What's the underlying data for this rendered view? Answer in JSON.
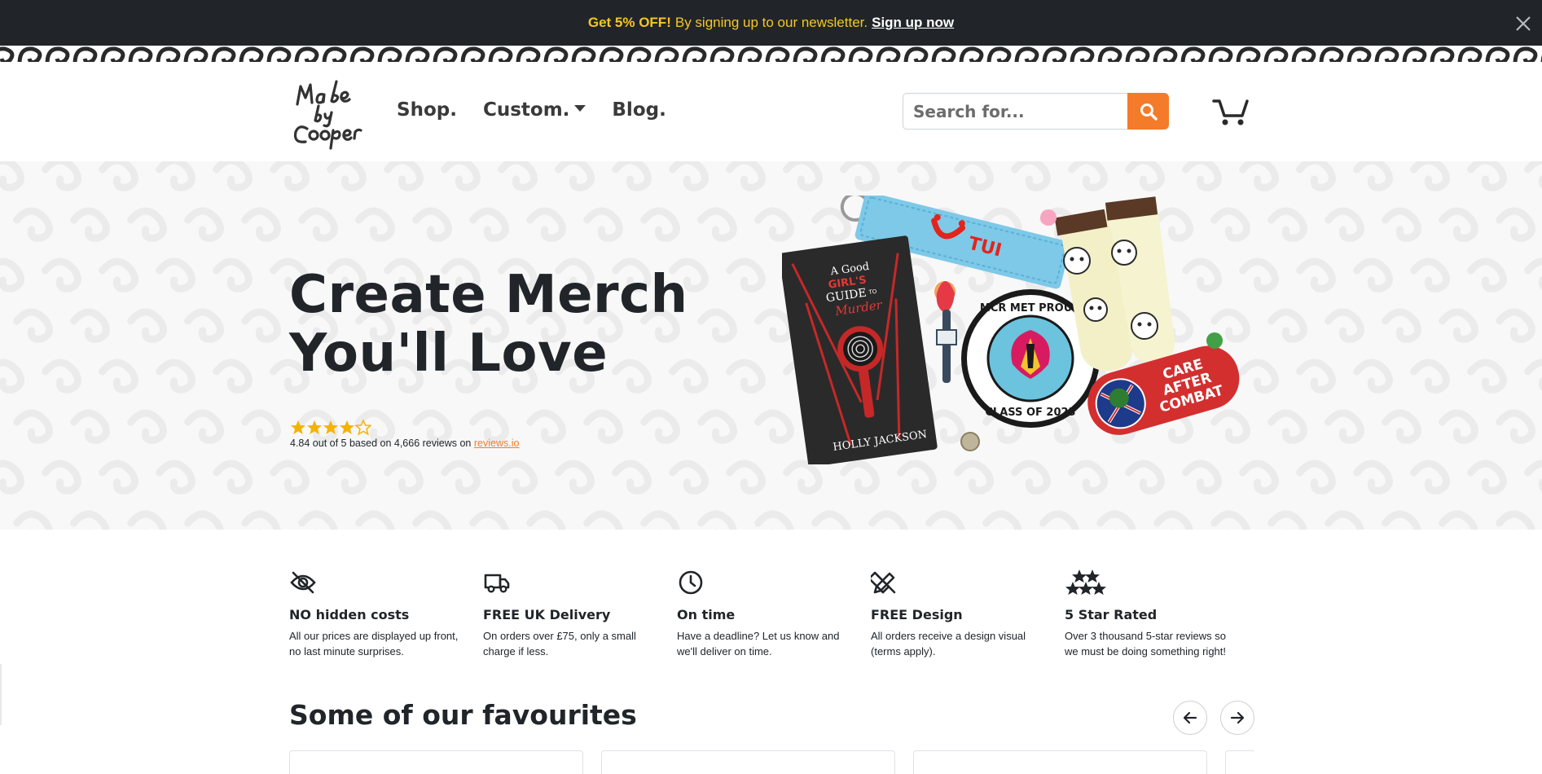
{
  "promo": {
    "strong": "Get 5% OFF!",
    "text": "By signing up to our newsletter.",
    "link": "Sign up now",
    "close_icon": "close-icon"
  },
  "header": {
    "logo_alt": "Made by Cooper",
    "nav": [
      {
        "label": "Shop."
      },
      {
        "label": "Custom.",
        "has_dropdown": true
      },
      {
        "label": "Blog."
      }
    ],
    "search_placeholder": "Search for...",
    "search_icon": "search-icon",
    "cart_icon": "cart-icon"
  },
  "hero": {
    "title_line1": "Create Merch",
    "title_line2": "You'll Love",
    "stars": 4.84,
    "rating_text": "4.84 out of 5 based on 4,666 reviews on",
    "rating_link": "reviews.io",
    "art": {
      "book_title_1": "A Good",
      "book_title_2": "GIRL'S",
      "book_title_3": "GUIDE",
      "book_title_4": "TO",
      "book_title_5": "Murder",
      "book_author": "HOLLY JACKSON",
      "keyring_text": "TUI",
      "patch_top": "MCR MET PROUD",
      "patch_bottom": "CLASS OF 2023",
      "badge_line1": "CARE",
      "badge_line2": "AFTER",
      "badge_line3": "COMBAT"
    }
  },
  "features": [
    {
      "icon": "eye-slash-icon",
      "title": "NO hidden costs",
      "text": "All our prices are displayed up front, no last minute surprises."
    },
    {
      "icon": "truck-icon",
      "title": "FREE UK Delivery",
      "text": "On orders over £75, only a small charge if less."
    },
    {
      "icon": "clock-icon",
      "title": "On time",
      "text": "Have a deadline? Let us know and we'll deliver on time."
    },
    {
      "icon": "design-tools-icon",
      "title": "FREE Design",
      "text": "All orders receive a design visual (terms apply)."
    },
    {
      "icon": "stars-icon",
      "title": "5 Star Rated",
      "text": "Over 3 thousand 5-star reviews so we must be doing something right!"
    }
  ],
  "favourites": {
    "title": "Some of our favourites",
    "prev_icon": "arrow-left-icon",
    "next_icon": "arrow-right-icon"
  },
  "colors": {
    "accent": "#f47b2a",
    "promo_bg": "#212529",
    "promo_text": "#f7c623",
    "text": "#212529"
  }
}
